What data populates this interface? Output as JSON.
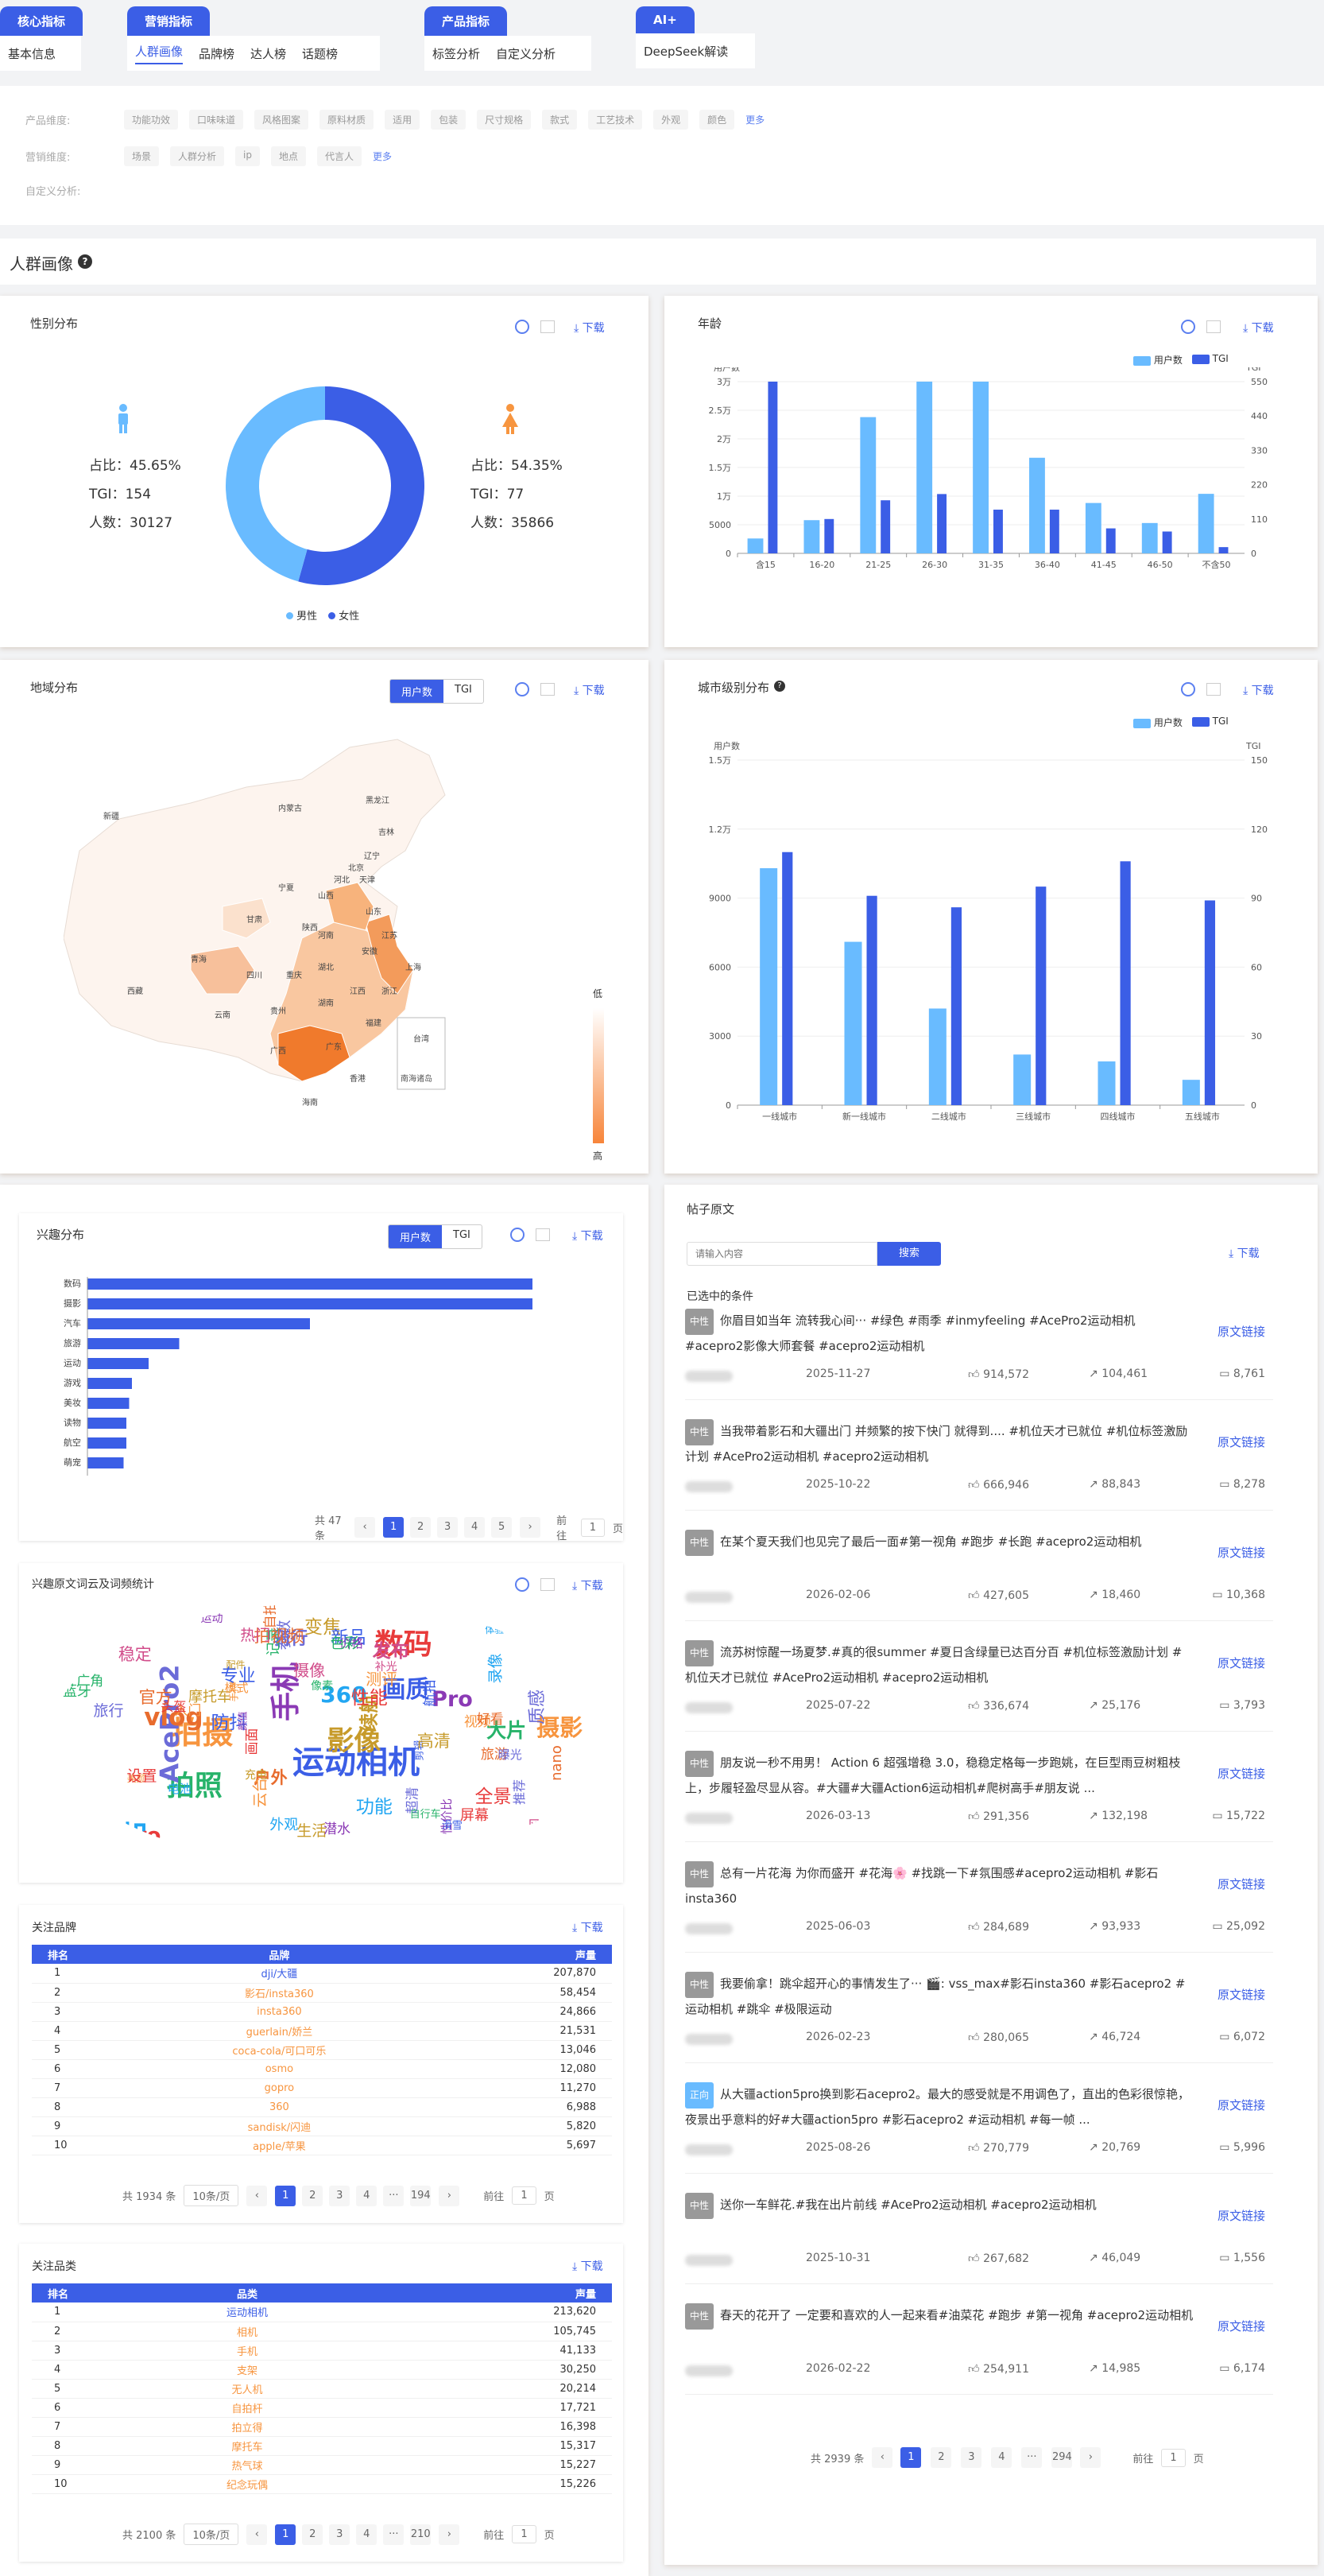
{
  "nav": {
    "groups": [
      {
        "title": "核心指标",
        "items": [
          "基本信息"
        ],
        "active": -1
      },
      {
        "title": "营销指标",
        "items": [
          "人群画像",
          "品牌榜",
          "达人榜",
          "话题榜"
        ],
        "active": 0
      },
      {
        "title": "产品指标",
        "items": [
          "标签分析",
          "自定义分析"
        ],
        "active": -1
      },
      {
        "title": "AI+",
        "items": [
          "DeepSeek解读"
        ],
        "active": -1
      }
    ]
  },
  "filters": {
    "product_label": "产品维度:",
    "product_chips": [
      "功能功效",
      "口味味道",
      "风格图案",
      "原料材质",
      "适用",
      "包装",
      "尺寸规格",
      "款式",
      "工艺技术",
      "外观",
      "颜色"
    ],
    "product_more": "更多",
    "marketing_label": "营销维度:",
    "marketing_chips": [
      "场景",
      "人群分析",
      "ip",
      "地点",
      "代言人"
    ],
    "marketing_more": "更多",
    "custom_label": "自定义分析:"
  },
  "section_title": "人群画像",
  "download": "下载",
  "gender": {
    "title": "性别分布",
    "male": {
      "ratio": "占比：45.65%",
      "tgi": "TGI：154",
      "count": "人数：30127",
      "share": 45.65
    },
    "female": {
      "ratio": "占比：54.35%",
      "tgi": "TGI：77",
      "count": "人数：35866",
      "share": 54.35
    },
    "legend": [
      "男性",
      "女性"
    ],
    "colors": {
      "male": "#69bbff",
      "female": "#3b5ee6"
    }
  },
  "age": {
    "title": "年龄",
    "legend": [
      "用户数",
      "TGI"
    ],
    "yl_label": "用户数",
    "yr_label": "TGI",
    "yl_ticks": [
      "0",
      "5000",
      "1万",
      "1.5万",
      "2万",
      "2.5万",
      "3万"
    ],
    "yr_ticks": [
      "0",
      "110",
      "220",
      "330",
      "440",
      "550"
    ]
  },
  "region": {
    "title": "地域分布",
    "seg": [
      "用户数",
      "TGI"
    ],
    "scale_top": "低",
    "scale_bottom": "高",
    "scale_min": "1",
    "scale_max": "22288",
    "inset": "南海诸岛",
    "provinces": [
      "新疆",
      "西藏",
      "青海",
      "甘肃",
      "内蒙古",
      "黑龙江",
      "吉林",
      "辽宁",
      "北京",
      "天津",
      "河北",
      "山西",
      "陕西",
      "宁夏",
      "山东",
      "河南",
      "四川",
      "重庆",
      "湖北",
      "安徽",
      "江苏",
      "上海",
      "浙江",
      "湖南",
      "江西",
      "福建",
      "贵州",
      "云南",
      "广西",
      "广东",
      "台湾",
      "海南",
      "香港"
    ]
  },
  "city": {
    "title": "城市级别分布",
    "legend": [
      "用户数",
      "TGI"
    ],
    "yl_label": "用户数",
    "yr_label": "TGI",
    "yl_ticks": [
      "0",
      "3000",
      "6000",
      "9000",
      "1.2万",
      "1.5万"
    ],
    "yr_ticks": [
      "0",
      "30",
      "60",
      "90",
      "120",
      "150"
    ]
  },
  "interest": {
    "title": "兴趣分布",
    "seg": [
      "用户数",
      "TGI"
    ],
    "total": "共 47 条",
    "goto": "前往",
    "page": "1",
    "unit": "页",
    "pages": [
      "1",
      "2",
      "3",
      "4",
      "5"
    ]
  },
  "wordcloud": {
    "title": "兴趣原文词云及词频统计",
    "words": [
      "运动相机",
      "拍摄",
      "相机",
      "手机",
      "数码",
      "拍照",
      "影像",
      "镜头",
      "AcePro2",
      "vlog",
      "画质",
      "摄影",
      "360",
      "Pro",
      "GoPro",
      "大片",
      "续航",
      "发布",
      "骑行",
      "户外",
      "防抖",
      "视频",
      "电池",
      "性价比",
      "全景",
      "蓝牙",
      "充电",
      "清晰",
      "参数",
      "旅游",
      "滑雪",
      "美颜",
      "录像",
      "夜景",
      "屏幕",
      "广角",
      "配件",
      "稳定",
      "旅行",
      "自拍",
      "航拍",
      "测评",
      "体验",
      "运动",
      "画面",
      "记录",
      "生活",
      "风景",
      "超清",
      "nano",
      "徕卡",
      "云台",
      "外观",
      "颜值",
      "设置",
      "像素",
      "变焦",
      "补光",
      "曝光",
      "官方",
      "新品",
      "入门",
      "便携",
      "潜水",
      "头盔",
      "自行车",
      "摩托车",
      "摄像",
      "质感",
      "拍视频",
      "剪辑",
      "模式",
      "功能",
      "价格",
      "性能",
      "色彩",
      "高清",
      "热门",
      "推荐",
      "好看",
      "专业",
      "手持"
    ]
  },
  "brands": {
    "title": "关注品牌",
    "cols": [
      "排名",
      "品牌",
      "声量"
    ],
    "rows": [
      [
        "1",
        "dji/大疆",
        "207,870"
      ],
      [
        "2",
        "影石/insta360",
        "58,454"
      ],
      [
        "3",
        "insta360",
        "24,866"
      ],
      [
        "4",
        "guerlain/娇兰",
        "21,531"
      ],
      [
        "5",
        "coca-cola/可口可乐",
        "13,046"
      ],
      [
        "6",
        "osmo",
        "12,080"
      ],
      [
        "7",
        "gopro",
        "11,270"
      ],
      [
        "8",
        "360",
        "6,988"
      ],
      [
        "9",
        "sandisk/闪迪",
        "5,820"
      ],
      [
        "10",
        "apple/苹果",
        "5,697"
      ]
    ],
    "total": "共 1934 条",
    "per": "10条/页",
    "pages": [
      "1",
      "2",
      "3",
      "4",
      "···",
      "194"
    ],
    "goto": "前往",
    "page": "1",
    "unit": "页"
  },
  "categories": {
    "title": "关注品类",
    "cols": [
      "排名",
      "品类",
      "声量"
    ],
    "rows": [
      [
        "1",
        "运动相机",
        "213,620"
      ],
      [
        "2",
        "相机",
        "105,745"
      ],
      [
        "3",
        "手机",
        "41,133"
      ],
      [
        "4",
        "支架",
        "30,250"
      ],
      [
        "5",
        "无人机",
        "20,214"
      ],
      [
        "6",
        "自拍杆",
        "17,721"
      ],
      [
        "7",
        "拍立得",
        "16,398"
      ],
      [
        "8",
        "摩托车",
        "15,317"
      ],
      [
        "9",
        "热气球",
        "15,227"
      ],
      [
        "10",
        "纪念玩偶",
        "15,226"
      ]
    ],
    "total": "共 2100 条",
    "per": "10条/页",
    "pages": [
      "1",
      "2",
      "3",
      "4",
      "···",
      "210"
    ],
    "goto": "前往",
    "page": "1",
    "unit": "页"
  },
  "posts": {
    "title": "帖子原文",
    "search_placeholder": "请输入内容",
    "search_btn": "搜索",
    "selected": "已选中的条件",
    "link": "原文链接",
    "items": [
      {
        "badge": "中性",
        "text": "你眉目如当年 流转我心间··· #绿色 #雨季 #inmyfeeling #AcePro2运动相机 #acepro2影像大师套餐 #acepro2运动相机",
        "date": "2025-11-27",
        "likes": "914,572",
        "shares": "104,461",
        "comments": "8,761"
      },
      {
        "badge": "中性",
        "text": "当我带着影石和大疆出门 并频繁的按下快门 就得到.... #机位天才已就位 #机位标签激励计划 #AcePro2运动相机 #acepro2运动相机",
        "date": "2025-10-22",
        "likes": "666,946",
        "shares": "88,843",
        "comments": "8,278"
      },
      {
        "badge": "中性",
        "text": "在某个夏天我们也见完了最后一面#第一视角 #跑步 #长跑 #acepro2运动相机",
        "date": "2026-02-06",
        "likes": "427,605",
        "shares": "18,460",
        "comments": "10,368"
      },
      {
        "badge": "中性",
        "text": "流苏树惊醒一场夏梦.#真的很summer #夏日含绿量已达百分百 #机位标签激励计划 #机位天才已就位 #AcePro2运动相机 #acepro2运动相机",
        "date": "2025-07-22",
        "likes": "336,674",
        "shares": "25,176",
        "comments": "3,793"
      },
      {
        "badge": "中性",
        "text": "朋友说一秒不用男！ Action 6 超强增稳 3.0，稳稳定格每一步跑姚，在巨型雨豆树粗枝上，步履轻盈尽显从容。#大疆#大疆Action6运动相机#爬树高手#朋友说 ...",
        "date": "2026-03-13",
        "likes": "291,356",
        "shares": "132,198",
        "comments": "15,722"
      },
      {
        "badge": "中性",
        "text": "总有一片花海 为你而盛开 #花海🌸 #找跳一下#氛围感#acepro2运动相机 #影石insta360",
        "date": "2025-06-03",
        "likes": "284,689",
        "shares": "93,933",
        "comments": "25,092"
      },
      {
        "badge": "中性",
        "text": "我要偷拿！跳伞超开心的事情发生了··· 🎬: vss_max#影石insta360 #影石acepro2 #运动相机 #跳伞 #极限运动",
        "date": "2026-02-23",
        "likes": "280,065",
        "shares": "46,724",
        "comments": "6,072"
      },
      {
        "badge": "正向",
        "text": "从大疆action5pro换到影石acepro2。最大的感受就是不用调色了，直出的色彩很惊艳，夜景出乎意料的好#大疆action5pro #影石acepro2 #运动相机 #每一帧 ...",
        "date": "2025-08-26",
        "likes": "270,779",
        "shares": "20,769",
        "comments": "5,996"
      },
      {
        "badge": "中性",
        "text": "送你一车鲜花.#我在出片前线 #AcePro2运动相机 #acepro2运动相机",
        "date": "2025-10-31",
        "likes": "267,682",
        "shares": "46,049",
        "comments": "1,556"
      },
      {
        "badge": "中性",
        "text": "春天的花开了 一定要和喜欢的人一起来看#油菜花 #跑步 #第一视角 #acepro2运动相机",
        "date": "2026-02-22",
        "likes": "254,911",
        "shares": "14,985",
        "comments": "6,174"
      }
    ],
    "total": "共 2939 条",
    "pages": [
      "1",
      "2",
      "3",
      "4",
      "···",
      "294"
    ],
    "goto": "前往",
    "page": "1",
    "unit": "页"
  },
  "chart_data": [
    {
      "type": "pie",
      "title": "性别分布",
      "categories": [
        "男性",
        "女性"
      ],
      "values": [
        45.65,
        54.35
      ]
    },
    {
      "type": "bar",
      "title": "年龄",
      "categories": [
        "含15",
        "16-20",
        "21-25",
        "26-30",
        "31-35",
        "36-40",
        "41-45",
        "46-50",
        "不含50"
      ],
      "series": [
        {
          "name": "用户数",
          "axis": "left",
          "values": [
            2600,
            5800,
            23800,
            30000,
            30000,
            16700,
            8800,
            5300,
            10400
          ]
        },
        {
          "name": "TGI",
          "axis": "right",
          "values": [
            550,
            110,
            170,
            190,
            140,
            140,
            80,
            70,
            20
          ]
        }
      ],
      "ylim_left": [
        0,
        30000
      ],
      "ylim_right": [
        0,
        550
      ]
    },
    {
      "type": "bar",
      "title": "城市级别分布",
      "categories": [
        "一线城市",
        "新一线城市",
        "二线城市",
        "三线城市",
        "四线城市",
        "五线城市"
      ],
      "series": [
        {
          "name": "用户数",
          "axis": "left",
          "values": [
            10300,
            7100,
            4200,
            2200,
            1900,
            1100
          ]
        },
        {
          "name": "TGI",
          "axis": "right",
          "values": [
            110,
            91,
            86,
            95,
            106,
            89
          ]
        }
      ],
      "ylim_left": [
        0,
        15000
      ],
      "ylim_right": [
        0,
        150
      ]
    },
    {
      "type": "bar",
      "title": "兴趣分布",
      "orientation": "horizontal",
      "categories": [
        "数码",
        "摄影",
        "汽车",
        "旅游",
        "运动",
        "游戏",
        "美妆",
        "读物",
        "航空",
        "萌宠"
      ],
      "values": [
        16000,
        16000,
        8000,
        3300,
        2200,
        1600,
        1500,
        1400,
        1400,
        1300
      ]
    }
  ]
}
